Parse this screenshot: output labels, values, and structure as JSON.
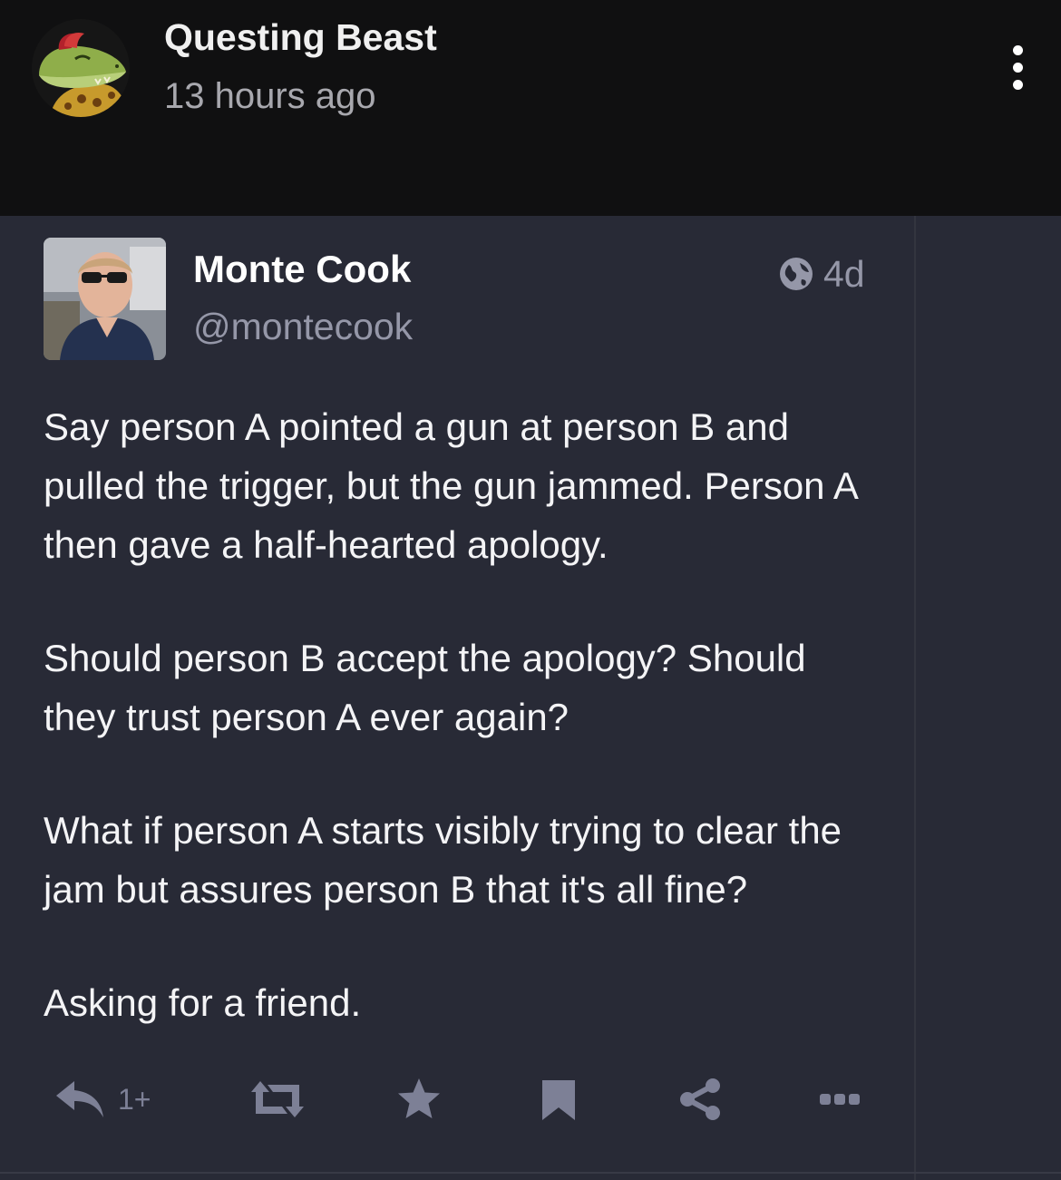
{
  "outer_post": {
    "author": "Questing Beast",
    "time_ago": "13 hours ago",
    "more_icon": "more-vertical-icon"
  },
  "toot": {
    "display_name": "Monte Cook",
    "handle": "@montecook",
    "visibility_icon": "globe-icon",
    "age": "4d",
    "paragraphs": [
      "Say person A pointed a gun at person B and pulled the trigger, but the gun jammed. Person A then gave a half-hearted apology.",
      "Should person B accept the apology? Should they trust person A ever again?",
      "What if person A starts visibly trying to clear the jam but assures person B that it's all fine?",
      "Asking for a friend."
    ],
    "actions": {
      "reply_icon": "reply-icon",
      "reply_count": "1+",
      "boost_icon": "boost-icon",
      "favourite_icon": "star-icon",
      "bookmark_icon": "bookmark-icon",
      "share_icon": "share-icon",
      "more_icon": "more-horizontal-icon"
    }
  },
  "colors": {
    "header_bg": "#101011",
    "card_bg": "#282a36",
    "muted_text": "#9597a8",
    "action_icon": "#7d8096"
  }
}
